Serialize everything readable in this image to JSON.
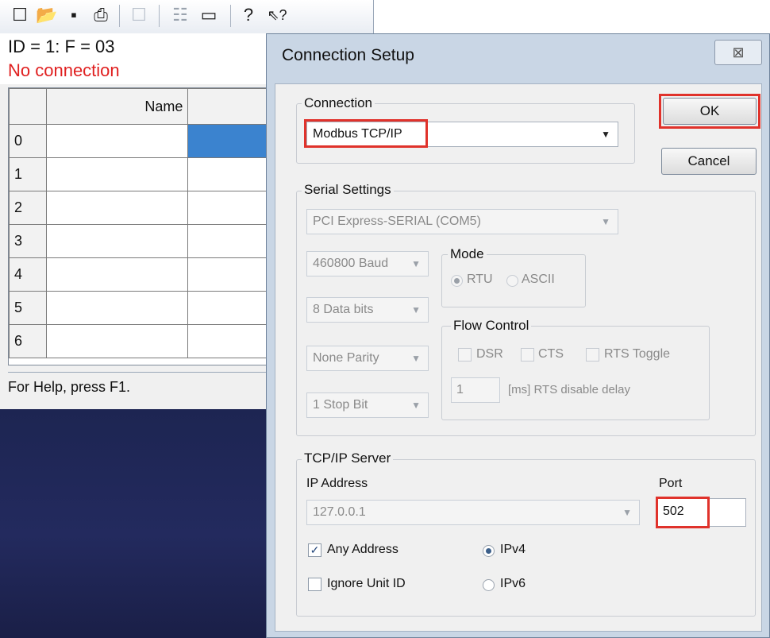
{
  "toolbar": {
    "icons": [
      "new-file-icon",
      "open-folder-icon",
      "save-icon",
      "print-icon",
      "blank-icon",
      "connect-icon",
      "display-icon",
      "help-icon",
      "context-help-icon"
    ],
    "glyphs": [
      "☐",
      "📂",
      "▪",
      "⎙",
      "☐",
      "☷",
      "▭",
      "?",
      "⇖?"
    ]
  },
  "status": {
    "id_line": "ID = 1: F = 03",
    "connection": "No connection"
  },
  "grid": {
    "header_name": "Name",
    "rows": [
      "0",
      "1",
      "2",
      "3",
      "4",
      "5",
      "6"
    ]
  },
  "helpbar": {
    "text": "For Help, press F1."
  },
  "dialog": {
    "title": "Connection Setup",
    "close_glyph": "⊠",
    "ok_label": "OK",
    "cancel_label": "Cancel",
    "connection": {
      "group_label": "Connection",
      "selected": "Modbus TCP/IP"
    },
    "serial": {
      "group_label": "Serial Settings",
      "port": "PCI Express-SERIAL (COM5)",
      "baud": "460800 Baud",
      "data_bits": "8 Data bits",
      "parity": "None Parity",
      "stop_bits": "1 Stop Bit",
      "mode_label": "Mode",
      "mode_rtu": "RTU",
      "mode_ascii": "ASCII",
      "flow_label": "Flow Control",
      "flow_dsr": "DSR",
      "flow_cts": "CTS",
      "flow_rts_toggle": "RTS Toggle",
      "rts_delay_value": "1",
      "rts_delay_label": "[ms] RTS disable delay"
    },
    "tcp": {
      "group_label": "TCP/IP Server",
      "ip_label": "IP Address",
      "ip_value": "127.0.0.1",
      "port_label": "Port",
      "port_value": "502",
      "any_address": "Any Address",
      "ignore_unit_id": "Ignore Unit ID",
      "ipv4": "IPv4",
      "ipv6": "IPv6"
    }
  },
  "colors": {
    "highlight": "#e0322b",
    "no_connection": "#e02020",
    "selected_cell": "#3b83cf"
  }
}
